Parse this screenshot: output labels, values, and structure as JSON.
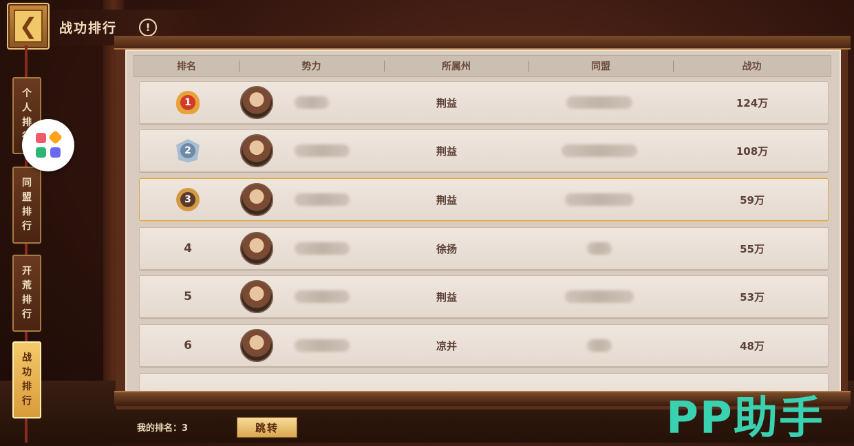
{
  "header": {
    "title": "战功排行",
    "info_glyph": "!",
    "back_glyph": "❮"
  },
  "side_tabs": [
    {
      "label": "个人排行",
      "active": false
    },
    {
      "label": "同盟排行",
      "active": false
    },
    {
      "label": "开荒排行",
      "active": false
    },
    {
      "label": "战功排行",
      "active": true
    }
  ],
  "table": {
    "columns": [
      "排名",
      "势力",
      "所属州",
      "同盟",
      "战功"
    ],
    "rows": [
      {
        "rank": "1",
        "state": "荆益",
        "merit": "124万",
        "medal": "gold"
      },
      {
        "rank": "2",
        "state": "荆益",
        "merit": "108万",
        "medal": "silver"
      },
      {
        "rank": "3",
        "state": "荆益",
        "merit": "59万",
        "medal": "bronze"
      },
      {
        "rank": "4",
        "state": "徐扬",
        "merit": "55万"
      },
      {
        "rank": "5",
        "state": "荆益",
        "merit": "53万"
      },
      {
        "rank": "6",
        "state": "凉并",
        "merit": "48万"
      }
    ]
  },
  "footer": {
    "my_rank_label": "我的排名：",
    "my_rank_value": "3",
    "jump_label": "跳转"
  },
  "watermark": "PP助手",
  "colors": {
    "accent_gold": "#f4c96a",
    "panel_bg": "#d9cbbf",
    "watermark": "#39d2b0"
  }
}
